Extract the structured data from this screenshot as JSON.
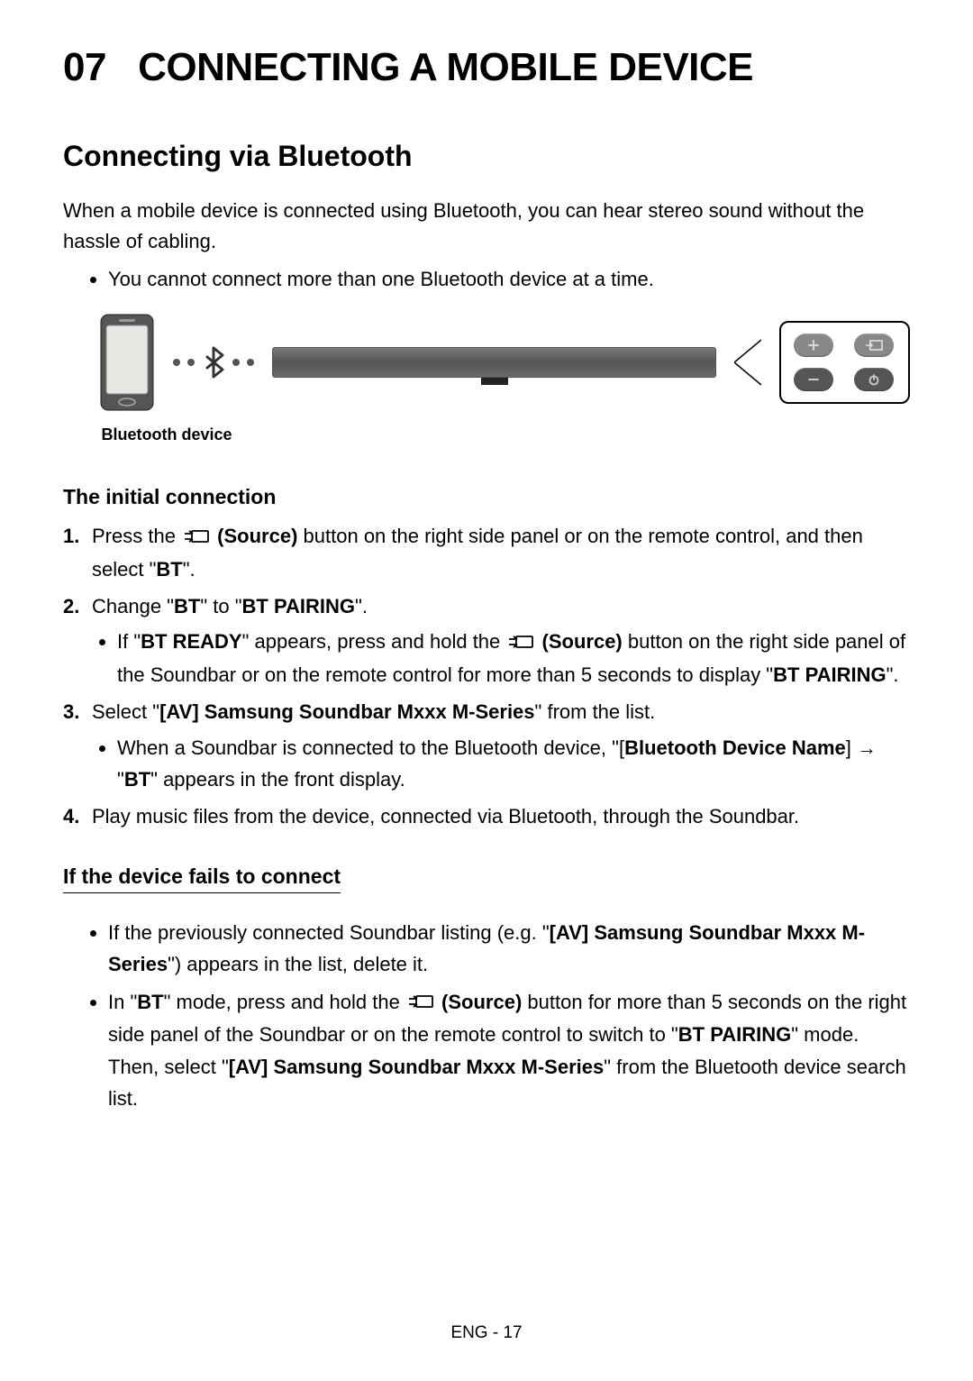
{
  "chapter": {
    "number": "07",
    "title": "CONNECTING A MOBILE DEVICE"
  },
  "section": {
    "title": "Connecting via Bluetooth"
  },
  "intro": "When a mobile device is connected using Bluetooth, you can hear stereo sound without the hassle of cabling.",
  "intro_bullet": "You cannot connect more than one Bluetooth device at a time.",
  "diagram": {
    "phone_label": "Bluetooth device"
  },
  "initial": {
    "heading": "The initial connection",
    "step1_a": "Press the ",
    "source_label": "(Source)",
    "step1_b": " button on the right side panel or on the remote control, and then select \"",
    "step1_bt": "BT",
    "step1_c": "\".",
    "step2_a": "Change \"",
    "step2_bt": "BT",
    "step2_b": "\" to \"",
    "step2_btp": "BT PAIRING",
    "step2_c": "\".",
    "step2_sub_a": "If \"",
    "step2_sub_btr": "BT READY",
    "step2_sub_b": "\" appears, press and hold the ",
    "step2_sub_c": " button on the right side panel of the Soundbar or on the remote control for more than 5 seconds to display \"",
    "step2_sub_btp": "BT PAIRING",
    "step2_sub_d": "\".",
    "step3_a": "Select \"",
    "step3_av": "[AV] Samsung Soundbar Mxxx M-Series",
    "step3_b": "\" from the list.",
    "step3_sub_a": "When a Soundbar is connected to the Bluetooth device, \"[",
    "step3_sub_bdn": "Bluetooth Device Name",
    "step3_sub_b": "] → \"",
    "step3_sub_bt": "BT",
    "step3_sub_c": "\" appears in the front display.",
    "step4": "Play music files from the device, connected via Bluetooth, through the Soundbar."
  },
  "fails": {
    "heading": "If the device fails to connect",
    "b1_a": "If the previously connected Soundbar listing (e.g. \"",
    "b1_av": "[AV] Samsung Soundbar Mxxx M-Series",
    "b1_b": "\") appears in the list, delete it.",
    "b2_a": "In \"",
    "b2_bt": "BT",
    "b2_b": "\" mode, press and hold the ",
    "b2_c": " button for more than 5 seconds on the right side panel of the Soundbar or on the remote control to switch to \"",
    "b2_btp": "BT PAIRING",
    "b2_d": "\" mode.",
    "b2_e": "Then, select \"",
    "b2_av": "[AV] Samsung Soundbar Mxxx M-Series",
    "b2_f": "\" from the Bluetooth device search list."
  },
  "footer": "ENG - 17"
}
